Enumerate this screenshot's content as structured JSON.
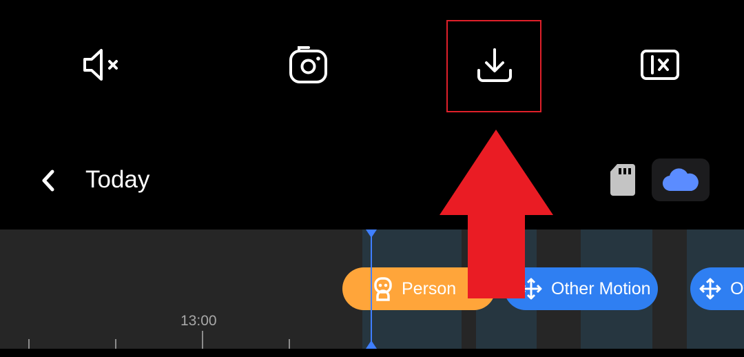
{
  "toolbar": {
    "mute_icon": "volume-mute-icon",
    "snapshot_icon": "camera-icon",
    "download_icon": "download-icon",
    "speed_icon": "speed-1x-icon"
  },
  "header": {
    "back_icon": "chevron-left-icon",
    "date_title": "Today",
    "sd_icon": "sd-card-icon",
    "cloud_icon": "cloud-icon"
  },
  "timeline": {
    "time_label": "13:00",
    "events": [
      {
        "label": "Person",
        "icon": "person-icon",
        "color": "#ffa53a"
      },
      {
        "label": "Other Motion",
        "icon": "move-icon",
        "color": "#2f7ff2"
      },
      {
        "label": "Ot",
        "icon": "move-icon",
        "color": "#2f7ff2"
      }
    ]
  },
  "colors": {
    "highlight": "#e0202a",
    "accent_blue": "#3f7fff",
    "cloud": "#5b8cff"
  }
}
